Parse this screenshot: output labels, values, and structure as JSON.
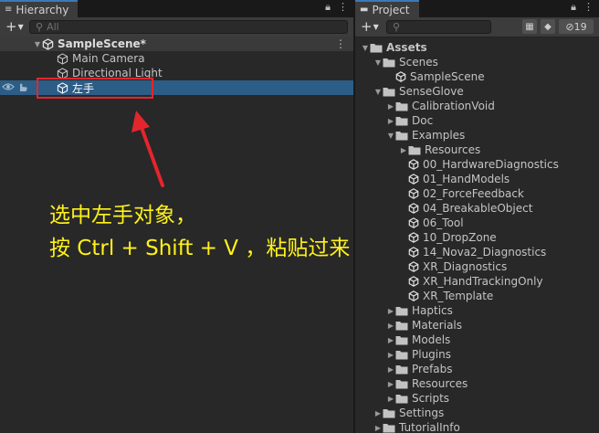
{
  "hierarchy": {
    "tab_title": "Hierarchy",
    "search_placeholder": "All",
    "scene_name": "SampleScene*",
    "items": [
      {
        "label": "Main Camera"
      },
      {
        "label": "Directional Light"
      },
      {
        "label": "左手"
      }
    ]
  },
  "project": {
    "tab_title": "Project",
    "hidden_count": "19",
    "tree": [
      {
        "label": "Assets",
        "icon": "folder-open-icon"
      },
      {
        "label": "Scenes",
        "icon": "folder-open-icon"
      },
      {
        "label": "SampleScene",
        "icon": "unity-scene-icon"
      },
      {
        "label": "SenseGlove",
        "icon": "folder-open-icon"
      },
      {
        "label": "CalibrationVoid",
        "icon": "folder-icon"
      },
      {
        "label": "Doc",
        "icon": "folder-icon"
      },
      {
        "label": "Examples",
        "icon": "folder-open-icon"
      },
      {
        "label": "Resources",
        "icon": "folder-icon"
      },
      {
        "label": "00_HardwareDiagnostics",
        "icon": "unity-scene-icon"
      },
      {
        "label": "01_HandModels",
        "icon": "unity-scene-icon"
      },
      {
        "label": "02_ForceFeedback",
        "icon": "unity-scene-icon"
      },
      {
        "label": "04_BreakableObject",
        "icon": "unity-scene-icon"
      },
      {
        "label": "06_Tool",
        "icon": "unity-scene-icon"
      },
      {
        "label": "10_DropZone",
        "icon": "unity-scene-icon"
      },
      {
        "label": "14_Nova2_Diagnostics",
        "icon": "unity-scene-icon"
      },
      {
        "label": "XR_Diagnostics",
        "icon": "unity-scene-icon"
      },
      {
        "label": "XR_HandTrackingOnly",
        "icon": "unity-scene-icon"
      },
      {
        "label": "XR_Template",
        "icon": "unity-scene-icon"
      },
      {
        "label": "Haptics",
        "icon": "folder-icon"
      },
      {
        "label": "Materials",
        "icon": "folder-icon"
      },
      {
        "label": "Models",
        "icon": "folder-icon"
      },
      {
        "label": "Plugins",
        "icon": "folder-icon"
      },
      {
        "label": "Prefabs",
        "icon": "folder-icon"
      },
      {
        "label": "Resources",
        "icon": "folder-icon"
      },
      {
        "label": "Scripts",
        "icon": "folder-icon"
      },
      {
        "label": "Settings",
        "icon": "folder-icon"
      },
      {
        "label": "TutorialInfo",
        "icon": "folder-icon"
      }
    ]
  },
  "annotation": {
    "line1": "选中左手对象，",
    "line2": "按 Ctrl + Shift + V ，粘贴过来"
  },
  "colors": {
    "selection": "#2c5d87",
    "annotation_text": "#fff21a",
    "annotation_box": "#e5252d"
  }
}
